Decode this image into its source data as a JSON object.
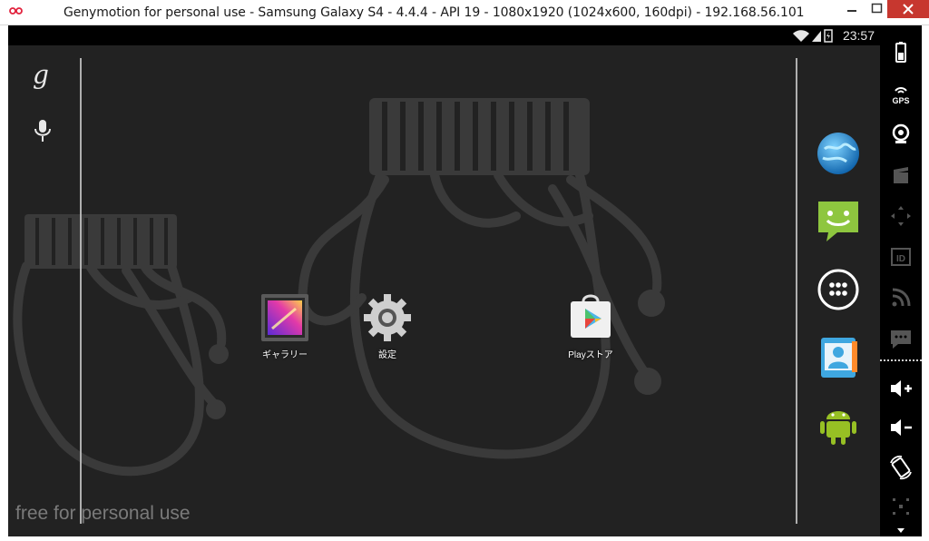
{
  "window": {
    "title": "Genymotion for personal use - Samsung Galaxy S4 - 4.4.4 - API 19 - 1080x1920 (1024x600, 160dpi) - 192.168.56.101",
    "controls": [
      "minimize-icon",
      "maximize-icon",
      "close-icon"
    ]
  },
  "status_bar": {
    "time": "23:57",
    "icons": [
      "wifi-icon",
      "signal-icon",
      "battery-icon"
    ]
  },
  "home": {
    "search": {
      "glyph": "g",
      "voice_icon": "mic-icon"
    },
    "apps": [
      {
        "label": "ギャラリー",
        "icon": "gallery-icon"
      },
      {
        "label": "設定",
        "icon": "settings-icon"
      },
      {
        "label": "Playストア",
        "icon": "play-store-icon"
      }
    ],
    "dock": [
      "browser-icon",
      "messaging-icon",
      "app-drawer-icon",
      "contacts-icon",
      "android-icon"
    ],
    "watermark": "free for personal use"
  },
  "toolbar": {
    "items": [
      "battery-widget-icon",
      "gps-widget-icon",
      "camera-widget-icon",
      "capture-widget-icon",
      "remote-control-icon",
      "identifiers-icon",
      "network-icon",
      "sms-icon",
      "volume-up-icon",
      "volume-down-icon",
      "rotate-icon",
      "pixel-perfect-icon"
    ],
    "gps_label": "GPS",
    "id_label": "ID"
  },
  "colors": {
    "close_button": "#c7372f",
    "screen_bg": "#222222",
    "wallpaper_lines": "#3a3a3a"
  }
}
